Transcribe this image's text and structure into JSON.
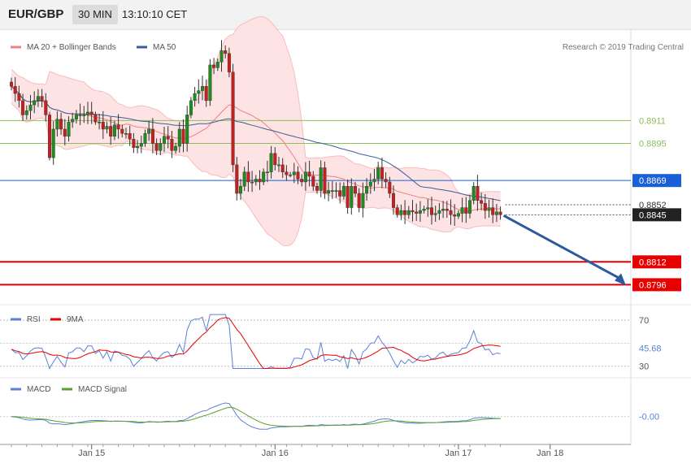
{
  "header": {
    "symbol": "EUR/GBP",
    "interval": "30 MIN",
    "time": "13:10:10 CET"
  },
  "copyright": "Research © 2019 Trading Central",
  "colors": {
    "ma20": "#f08080",
    "band_fill": "#fde3e3",
    "ma50": "#3a5f9a",
    "up": "#1e8c1e",
    "down": "#c81e1e",
    "resistance": "#8cbf5a",
    "pivot": "#1a5fd6",
    "support": "#e60000",
    "arrow": "#2c5a9e",
    "rsi": "#5b82d6",
    "macd": "#5b82d6",
    "signal": "#5aa02c"
  },
  "chart_data": [
    {
      "type": "candlestick",
      "legend": [
        {
          "name": "MA 20 + Bollinger Bands",
          "color": "#f08080"
        },
        {
          "name": "MA 50",
          "color": "#3a5f9a"
        }
      ],
      "x_ticks": [
        {
          "label": "Jan 15",
          "index": 21
        },
        {
          "label": "Jan 16",
          "index": 69
        },
        {
          "label": "Jan 17",
          "index": 117
        },
        {
          "label": "Jan 18",
          "index": 141
        }
      ],
      "ylim": [
        0.8782,
        0.8975
      ],
      "levels": [
        {
          "label": "0.8911",
          "value": 0.8911,
          "kind": "resistance"
        },
        {
          "label": "0.8895",
          "value": 0.8895,
          "kind": "resistance"
        },
        {
          "label": "0.8869",
          "value": 0.8869,
          "kind": "pivot"
        },
        {
          "label": "0.8812",
          "value": 0.8812,
          "kind": "support"
        },
        {
          "label": "0.8796",
          "value": 0.8796,
          "kind": "support"
        }
      ],
      "price_markers": [
        {
          "label": "0.8852",
          "value": 0.8852,
          "kind": "ma"
        },
        {
          "label": "0.8845",
          "value": 0.8845,
          "kind": "last"
        }
      ],
      "closes": [
        0.8935,
        0.893,
        0.8925,
        0.8915,
        0.8918,
        0.8922,
        0.8925,
        0.8928,
        0.8925,
        0.8915,
        0.8885,
        0.8905,
        0.8912,
        0.8905,
        0.89,
        0.891,
        0.8912,
        0.8915,
        0.8915,
        0.8915,
        0.8917,
        0.8915,
        0.891,
        0.891,
        0.8905,
        0.8907,
        0.89,
        0.8908,
        0.8905,
        0.8902,
        0.8902,
        0.8898,
        0.8892,
        0.8893,
        0.8895,
        0.8902,
        0.8905,
        0.8895,
        0.889,
        0.8895,
        0.89,
        0.8898,
        0.889,
        0.8893,
        0.8905,
        0.8895,
        0.8915,
        0.8925,
        0.893,
        0.8932,
        0.8935,
        0.8925,
        0.895,
        0.8948,
        0.8952,
        0.896,
        0.8958,
        0.8945,
        0.888,
        0.886,
        0.8865,
        0.8875,
        0.8868,
        0.8868,
        0.887,
        0.8868,
        0.8875,
        0.8875,
        0.8888,
        0.888,
        0.888,
        0.8875,
        0.8873,
        0.8873,
        0.8875,
        0.887,
        0.8868,
        0.8875,
        0.8872,
        0.8865,
        0.8862,
        0.8878,
        0.886,
        0.8862,
        0.8862,
        0.8862,
        0.8858,
        0.8865,
        0.885,
        0.8865,
        0.886,
        0.885,
        0.886,
        0.8865,
        0.8868,
        0.887,
        0.8878,
        0.887,
        0.8868,
        0.886,
        0.885,
        0.8845,
        0.8848,
        0.8845,
        0.8848,
        0.8847,
        0.8846,
        0.8848,
        0.8849,
        0.885,
        0.8845,
        0.8846,
        0.8848,
        0.8849,
        0.8848,
        0.8845,
        0.8844,
        0.8846,
        0.885,
        0.8846,
        0.8855,
        0.8865,
        0.8855,
        0.8853,
        0.8848,
        0.885,
        0.8845,
        0.8847,
        0.8845
      ],
      "panels": [
        {
          "name": "RSI",
          "legend": [
            {
              "name": "RSI",
              "color": "#5b82d6"
            },
            {
              "name": "9MA",
              "color": "#e60000"
            }
          ],
          "ticks": [
            {
              "label": "70",
              "value": 70
            },
            {
              "label": "30",
              "value": 30
            }
          ],
          "ylim": [
            22,
            80
          ],
          "value_label": "45.68",
          "value": 45.68
        },
        {
          "name": "MACD",
          "legend": [
            {
              "name": "MACD",
              "color": "#5b82d6"
            },
            {
              "name": "MACD Signal",
              "color": "#5aa02c"
            }
          ],
          "ylim": [
            -0.0026,
            0.0036
          ],
          "value_label": "-0.00",
          "value": 0.0
        }
      ]
    }
  ]
}
